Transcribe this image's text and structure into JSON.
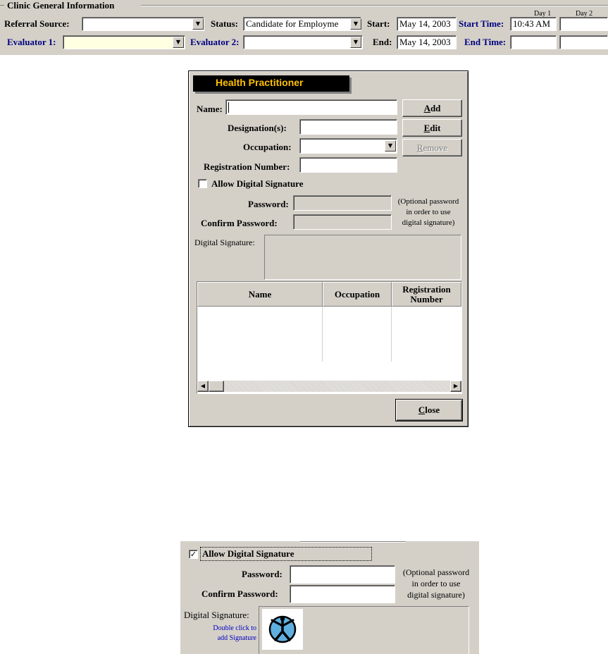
{
  "top": {
    "group_title": "Clinic General Information",
    "referral_label": "Referral Source:",
    "referral_value": "",
    "status_label": "Status:",
    "status_value": "Candidate for Employme",
    "start_label": "Start:",
    "start_value": "May 14, 2003",
    "start_time_label": "Start Time:",
    "start_time_value": "10:43 AM",
    "day1": "Day 1",
    "day2": "Day 2",
    "evaluator1_label": "Evaluator 1:",
    "evaluator1_value": "",
    "evaluator2_label": "Evaluator 2:",
    "evaluator2_value": "",
    "end_label": "End:",
    "end_value": "May 14, 2003",
    "end_time_label": "End Time:",
    "end_time_value": ""
  },
  "dialog": {
    "title": "Health Practitioner",
    "name_label": "Name:",
    "designations_label": "Designation(s):",
    "occupation_label": "Occupation:",
    "registration_label": "Registration Number:",
    "allow_signature_label": "Allow Digital Signature",
    "allow_signature_checked": false,
    "password_label": "Password:",
    "confirm_password_label": "Confirm Password:",
    "password_note": [
      "(Optional password",
      "in order to use",
      "digital signature)"
    ],
    "digital_signature_label": "Digital Signature:",
    "buttons": {
      "add_prefix": "",
      "add_ul": "A",
      "add_rest": "dd",
      "edit_ul": "E",
      "edit_rest": "dit",
      "remove_ul": "R",
      "remove_rest": "emove",
      "close_ul": "C",
      "close_rest": "lose"
    },
    "table": {
      "columns": [
        "Name",
        "Occupation",
        "Registration Number"
      ],
      "rows": []
    }
  },
  "inset": {
    "allow_signature_label": "Allow Digital Signature",
    "allow_signature_checked": true,
    "password_label": "Password:",
    "confirm_password_label": "Confirm Password:",
    "password_note": [
      "(Optional password",
      "in order to use",
      "digital signature)"
    ],
    "digital_signature_label": "Digital Signature:",
    "signature_hint": [
      "Double click to",
      "add Signature"
    ],
    "signature_icon": "vitruvian-figure-icon"
  }
}
